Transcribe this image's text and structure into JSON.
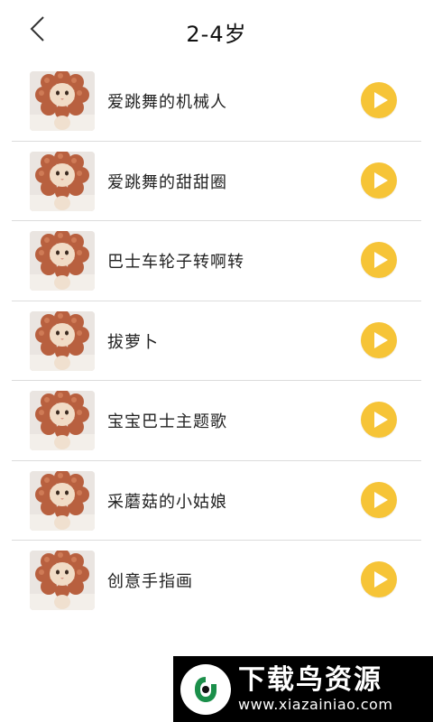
{
  "header": {
    "title": "2-4岁"
  },
  "songs": [
    {
      "title": "爱跳舞的机械人"
    },
    {
      "title": "爱跳舞的甜甜圈"
    },
    {
      "title": "巴士车轮子转啊转"
    },
    {
      "title": "拔萝卜"
    },
    {
      "title": "宝宝巴士主题歌"
    },
    {
      "title": "采蘑菇的小姑娘"
    },
    {
      "title": "创意手指画"
    }
  ],
  "watermark": {
    "name": "下载鸟资源",
    "url": "www.xiazainiao.com"
  },
  "colors": {
    "accent": "#f6c437",
    "divider": "#dcdcdc"
  }
}
